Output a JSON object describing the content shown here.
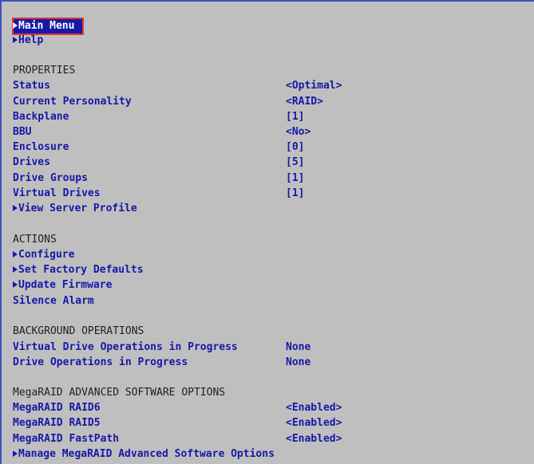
{
  "nav": {
    "main_menu": "Main Menu",
    "help": "Help"
  },
  "properties": {
    "header": "PROPERTIES",
    "items": [
      {
        "label": "Status",
        "value": "<Optimal>"
      },
      {
        "label": "Current Personality",
        "value": "<RAID>"
      },
      {
        "label": "Backplane",
        "value": "[1]"
      },
      {
        "label": "BBU",
        "value": "<No>"
      },
      {
        "label": "Enclosure",
        "value": "[0]"
      },
      {
        "label": "Drives",
        "value": "[5]"
      },
      {
        "label": "Drive Groups",
        "value": "[1]"
      },
      {
        "label": "Virtual Drives",
        "value": "[1]"
      }
    ],
    "view_server_profile": "View Server Profile"
  },
  "actions": {
    "header": "ACTIONS",
    "configure": "Configure",
    "set_factory_defaults": "Set Factory Defaults",
    "update_firmware": "Update Firmware",
    "silence_alarm": "Silence Alarm"
  },
  "background_operations": {
    "header": "BACKGROUND OPERATIONS",
    "items": [
      {
        "label": "Virtual Drive Operations in Progress",
        "value": "None"
      },
      {
        "label": "Drive Operations in Progress",
        "value": "None"
      }
    ]
  },
  "advanced_options": {
    "header": "MegaRAID ADVANCED SOFTWARE OPTIONS",
    "items": [
      {
        "label": "MegaRAID RAID6",
        "value": "<Enabled>"
      },
      {
        "label": "MegaRAID RAID5",
        "value": "<Enabled>"
      },
      {
        "label": "MegaRAID FastPath",
        "value": "<Enabled>"
      }
    ],
    "manage": "Manage MegaRAID Advanced Software Options"
  },
  "colors": {
    "background": "#bfbfbf",
    "text_blue": "#1818a8",
    "highlight": "#1818a8",
    "selection_border": "#e53535"
  }
}
